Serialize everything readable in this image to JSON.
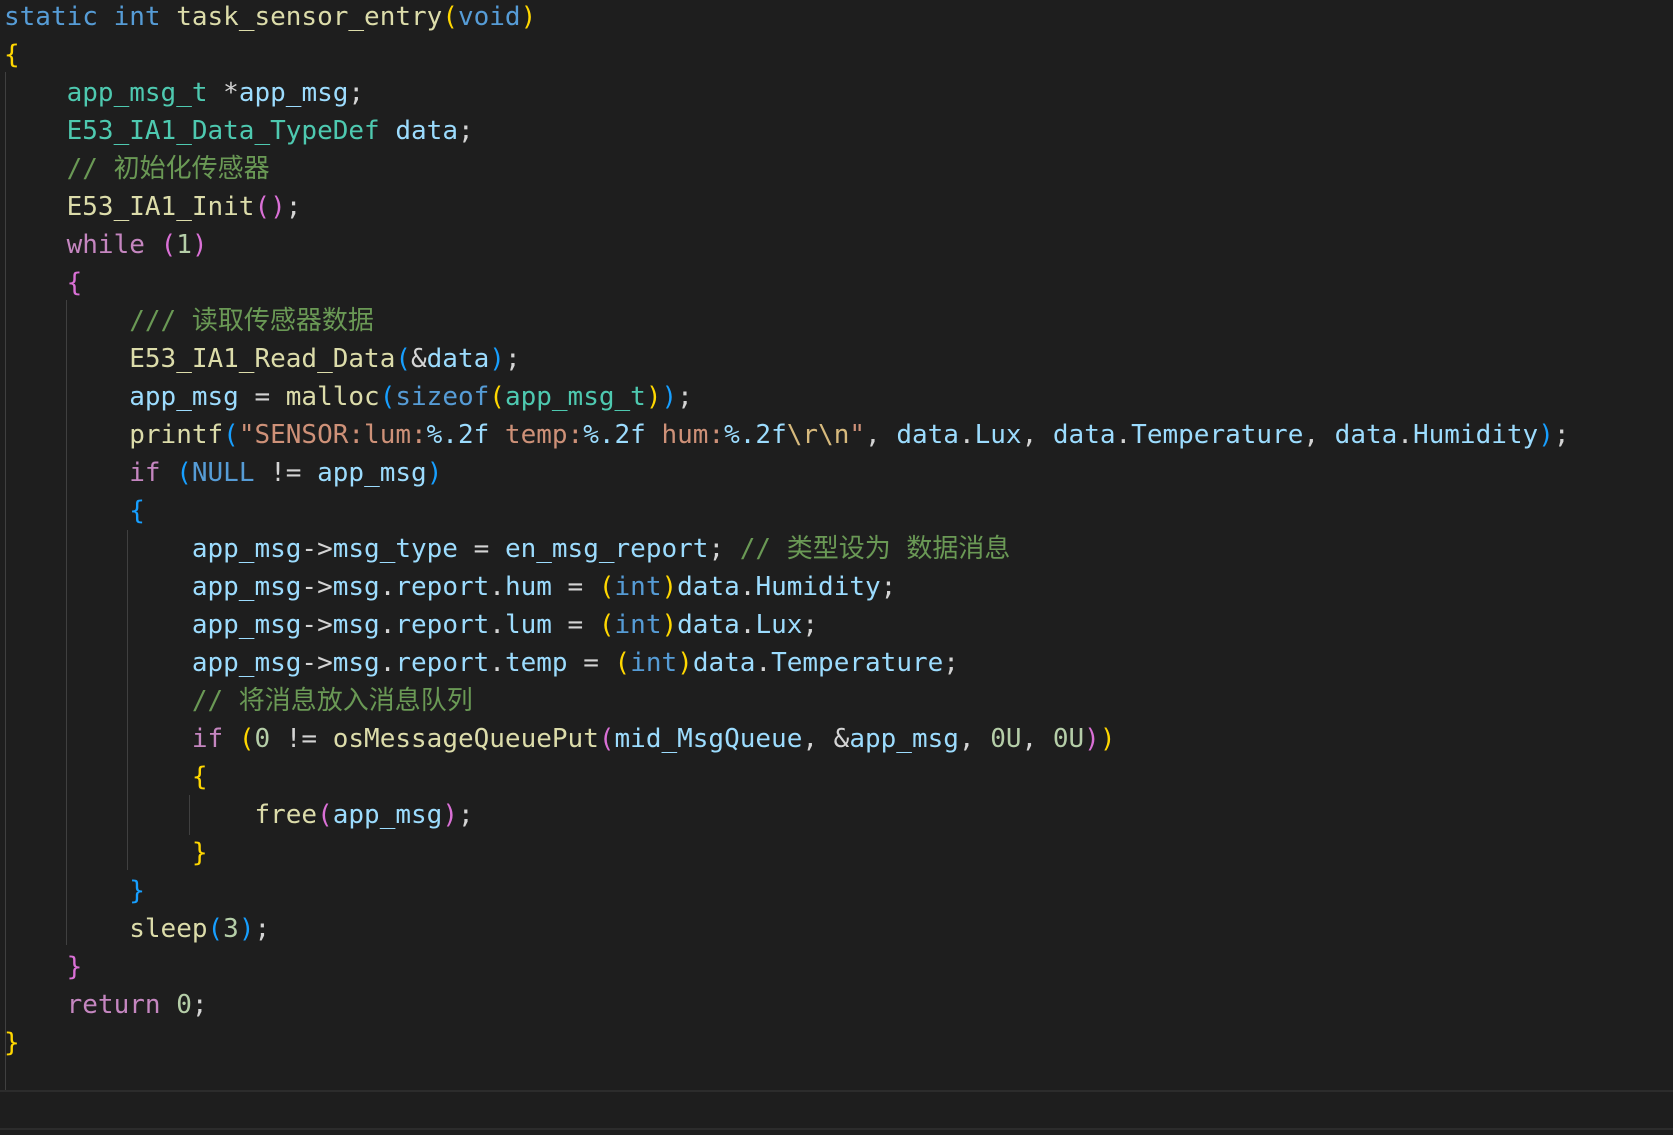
{
  "lines": [
    [
      {
        "t": "static",
        "c": "kw"
      },
      {
        "t": " ",
        "c": ""
      },
      {
        "t": "int",
        "c": "kw"
      },
      {
        "t": " ",
        "c": ""
      },
      {
        "t": "task_sensor_entry",
        "c": "fn"
      },
      {
        "t": "(",
        "c": "b1"
      },
      {
        "t": "void",
        "c": "kw"
      },
      {
        "t": ")",
        "c": "b1"
      }
    ],
    [
      {
        "t": "{",
        "c": "b1"
      }
    ],
    [
      {
        "t": "    ",
        "c": ""
      },
      {
        "t": "app_msg_t",
        "c": "type"
      },
      {
        "t": " *",
        "c": ""
      },
      {
        "t": "app_msg",
        "c": "var"
      },
      {
        "t": ";",
        "c": ""
      }
    ],
    [
      {
        "t": "    ",
        "c": ""
      },
      {
        "t": "E53_IA1_Data_TypeDef",
        "c": "type"
      },
      {
        "t": " ",
        "c": ""
      },
      {
        "t": "data",
        "c": "var"
      },
      {
        "t": ";",
        "c": ""
      }
    ],
    [
      {
        "t": "    ",
        "c": ""
      },
      {
        "t": "// 初始化传感器",
        "c": "cmt"
      }
    ],
    [
      {
        "t": "    ",
        "c": ""
      },
      {
        "t": "E53_IA1_Init",
        "c": "fn"
      },
      {
        "t": "()",
        "c": "b2"
      },
      {
        "t": ";",
        "c": ""
      }
    ],
    [
      {
        "t": "    ",
        "c": ""
      },
      {
        "t": "while",
        "c": "ctl"
      },
      {
        "t": " ",
        "c": ""
      },
      {
        "t": "(",
        "c": "b2"
      },
      {
        "t": "1",
        "c": "num"
      },
      {
        "t": ")",
        "c": "b2"
      }
    ],
    [
      {
        "t": "    ",
        "c": ""
      },
      {
        "t": "{",
        "c": "b2"
      }
    ],
    [
      {
        "t": "        ",
        "c": ""
      },
      {
        "t": "/// 读取传感器数据",
        "c": "cmt"
      }
    ],
    [
      {
        "t": "        ",
        "c": ""
      },
      {
        "t": "E53_IA1_Read_Data",
        "c": "fn"
      },
      {
        "t": "(",
        "c": "b3"
      },
      {
        "t": "&",
        "c": ""
      },
      {
        "t": "data",
        "c": "var"
      },
      {
        "t": ")",
        "c": "b3"
      },
      {
        "t": ";",
        "c": ""
      }
    ],
    [
      {
        "t": "        ",
        "c": ""
      },
      {
        "t": "app_msg",
        "c": "var"
      },
      {
        "t": " = ",
        "c": ""
      },
      {
        "t": "malloc",
        "c": "fn"
      },
      {
        "t": "(",
        "c": "b3"
      },
      {
        "t": "sizeof",
        "c": "kw"
      },
      {
        "t": "(",
        "c": "b1"
      },
      {
        "t": "app_msg_t",
        "c": "type"
      },
      {
        "t": ")",
        "c": "b1"
      },
      {
        "t": ")",
        "c": "b3"
      },
      {
        "t": ";",
        "c": ""
      }
    ],
    [
      {
        "t": "        ",
        "c": ""
      },
      {
        "t": "printf",
        "c": "fn"
      },
      {
        "t": "(",
        "c": "b3"
      },
      {
        "t": "\"SENSOR:lum:",
        "c": "str"
      },
      {
        "t": "%.2f",
        "c": "fmt"
      },
      {
        "t": " temp:",
        "c": "str"
      },
      {
        "t": "%.2f",
        "c": "fmt"
      },
      {
        "t": " hum:",
        "c": "str"
      },
      {
        "t": "%.2f",
        "c": "fmt"
      },
      {
        "t": "\\r\\n",
        "c": "esc"
      },
      {
        "t": "\"",
        "c": "str"
      },
      {
        "t": ", ",
        "c": ""
      },
      {
        "t": "data",
        "c": "var"
      },
      {
        "t": ".",
        "c": ""
      },
      {
        "t": "Lux",
        "c": "var"
      },
      {
        "t": ", ",
        "c": ""
      },
      {
        "t": "data",
        "c": "var"
      },
      {
        "t": ".",
        "c": ""
      },
      {
        "t": "Temperature",
        "c": "var"
      },
      {
        "t": ", ",
        "c": ""
      },
      {
        "t": "data",
        "c": "var"
      },
      {
        "t": ".",
        "c": ""
      },
      {
        "t": "Humidity",
        "c": "var"
      },
      {
        "t": ")",
        "c": "b3"
      },
      {
        "t": ";",
        "c": ""
      }
    ],
    [
      {
        "t": "        ",
        "c": ""
      },
      {
        "t": "if",
        "c": "ctl"
      },
      {
        "t": " ",
        "c": ""
      },
      {
        "t": "(",
        "c": "b3"
      },
      {
        "t": "NULL",
        "c": "macro"
      },
      {
        "t": " != ",
        "c": ""
      },
      {
        "t": "app_msg",
        "c": "var"
      },
      {
        "t": ")",
        "c": "b3"
      }
    ],
    [
      {
        "t": "        ",
        "c": ""
      },
      {
        "t": "{",
        "c": "b3"
      }
    ],
    [
      {
        "t": "            ",
        "c": ""
      },
      {
        "t": "app_msg",
        "c": "var"
      },
      {
        "t": "->",
        "c": ""
      },
      {
        "t": "msg_type",
        "c": "var"
      },
      {
        "t": " = ",
        "c": ""
      },
      {
        "t": "en_msg_report",
        "c": "var"
      },
      {
        "t": "; ",
        "c": ""
      },
      {
        "t": "// 类型设为 数据消息",
        "c": "cmt"
      }
    ],
    [
      {
        "t": "            ",
        "c": ""
      },
      {
        "t": "app_msg",
        "c": "var"
      },
      {
        "t": "->",
        "c": ""
      },
      {
        "t": "msg",
        "c": "var"
      },
      {
        "t": ".",
        "c": ""
      },
      {
        "t": "report",
        "c": "var"
      },
      {
        "t": ".",
        "c": ""
      },
      {
        "t": "hum",
        "c": "var"
      },
      {
        "t": " = ",
        "c": ""
      },
      {
        "t": "(",
        "c": "b1"
      },
      {
        "t": "int",
        "c": "kw"
      },
      {
        "t": ")",
        "c": "b1"
      },
      {
        "t": "data",
        "c": "var"
      },
      {
        "t": ".",
        "c": ""
      },
      {
        "t": "Humidity",
        "c": "var"
      },
      {
        "t": ";",
        "c": ""
      }
    ],
    [
      {
        "t": "            ",
        "c": ""
      },
      {
        "t": "app_msg",
        "c": "var"
      },
      {
        "t": "->",
        "c": ""
      },
      {
        "t": "msg",
        "c": "var"
      },
      {
        "t": ".",
        "c": ""
      },
      {
        "t": "report",
        "c": "var"
      },
      {
        "t": ".",
        "c": ""
      },
      {
        "t": "lum",
        "c": "var"
      },
      {
        "t": " = ",
        "c": ""
      },
      {
        "t": "(",
        "c": "b1"
      },
      {
        "t": "int",
        "c": "kw"
      },
      {
        "t": ")",
        "c": "b1"
      },
      {
        "t": "data",
        "c": "var"
      },
      {
        "t": ".",
        "c": ""
      },
      {
        "t": "Lux",
        "c": "var"
      },
      {
        "t": ";",
        "c": ""
      }
    ],
    [
      {
        "t": "            ",
        "c": ""
      },
      {
        "t": "app_msg",
        "c": "var"
      },
      {
        "t": "->",
        "c": ""
      },
      {
        "t": "msg",
        "c": "var"
      },
      {
        "t": ".",
        "c": ""
      },
      {
        "t": "report",
        "c": "var"
      },
      {
        "t": ".",
        "c": ""
      },
      {
        "t": "temp",
        "c": "var"
      },
      {
        "t": " = ",
        "c": ""
      },
      {
        "t": "(",
        "c": "b1"
      },
      {
        "t": "int",
        "c": "kw"
      },
      {
        "t": ")",
        "c": "b1"
      },
      {
        "t": "data",
        "c": "var"
      },
      {
        "t": ".",
        "c": ""
      },
      {
        "t": "Temperature",
        "c": "var"
      },
      {
        "t": ";",
        "c": ""
      }
    ],
    [
      {
        "t": "            ",
        "c": ""
      },
      {
        "t": "// 将消息放入消息队列",
        "c": "cmt"
      }
    ],
    [
      {
        "t": "            ",
        "c": ""
      },
      {
        "t": "if",
        "c": "ctl"
      },
      {
        "t": " ",
        "c": ""
      },
      {
        "t": "(",
        "c": "b1"
      },
      {
        "t": "0",
        "c": "num"
      },
      {
        "t": " != ",
        "c": ""
      },
      {
        "t": "osMessageQueuePut",
        "c": "fn"
      },
      {
        "t": "(",
        "c": "b2"
      },
      {
        "t": "mid_MsgQueue",
        "c": "var"
      },
      {
        "t": ", &",
        "c": ""
      },
      {
        "t": "app_msg",
        "c": "var"
      },
      {
        "t": ", ",
        "c": ""
      },
      {
        "t": "0U",
        "c": "num"
      },
      {
        "t": ", ",
        "c": ""
      },
      {
        "t": "0U",
        "c": "num"
      },
      {
        "t": ")",
        "c": "b2"
      },
      {
        "t": ")",
        "c": "b1"
      }
    ],
    [
      {
        "t": "            ",
        "c": ""
      },
      {
        "t": "{",
        "c": "b1"
      }
    ],
    [
      {
        "t": "                ",
        "c": ""
      },
      {
        "t": "free",
        "c": "fn"
      },
      {
        "t": "(",
        "c": "b2"
      },
      {
        "t": "app_msg",
        "c": "var"
      },
      {
        "t": ")",
        "c": "b2"
      },
      {
        "t": ";",
        "c": ""
      }
    ],
    [
      {
        "t": "            ",
        "c": ""
      },
      {
        "t": "}",
        "c": "b1"
      }
    ],
    [
      {
        "t": "        ",
        "c": ""
      },
      {
        "t": "}",
        "c": "b3"
      }
    ],
    [
      {
        "t": "        ",
        "c": ""
      },
      {
        "t": "sleep",
        "c": "fn"
      },
      {
        "t": "(",
        "c": "b3"
      },
      {
        "t": "3",
        "c": "num"
      },
      {
        "t": ")",
        "c": "b3"
      },
      {
        "t": ";",
        "c": ""
      }
    ],
    [
      {
        "t": "    ",
        "c": ""
      },
      {
        "t": "}",
        "c": "b2"
      }
    ],
    [
      {
        "t": "    ",
        "c": ""
      },
      {
        "t": "return",
        "c": "ctl"
      },
      {
        "t": " ",
        "c": ""
      },
      {
        "t": "0",
        "c": "num"
      },
      {
        "t": ";",
        "c": ""
      }
    ],
    [
      {
        "t": "}",
        "c": "b1"
      }
    ]
  ]
}
